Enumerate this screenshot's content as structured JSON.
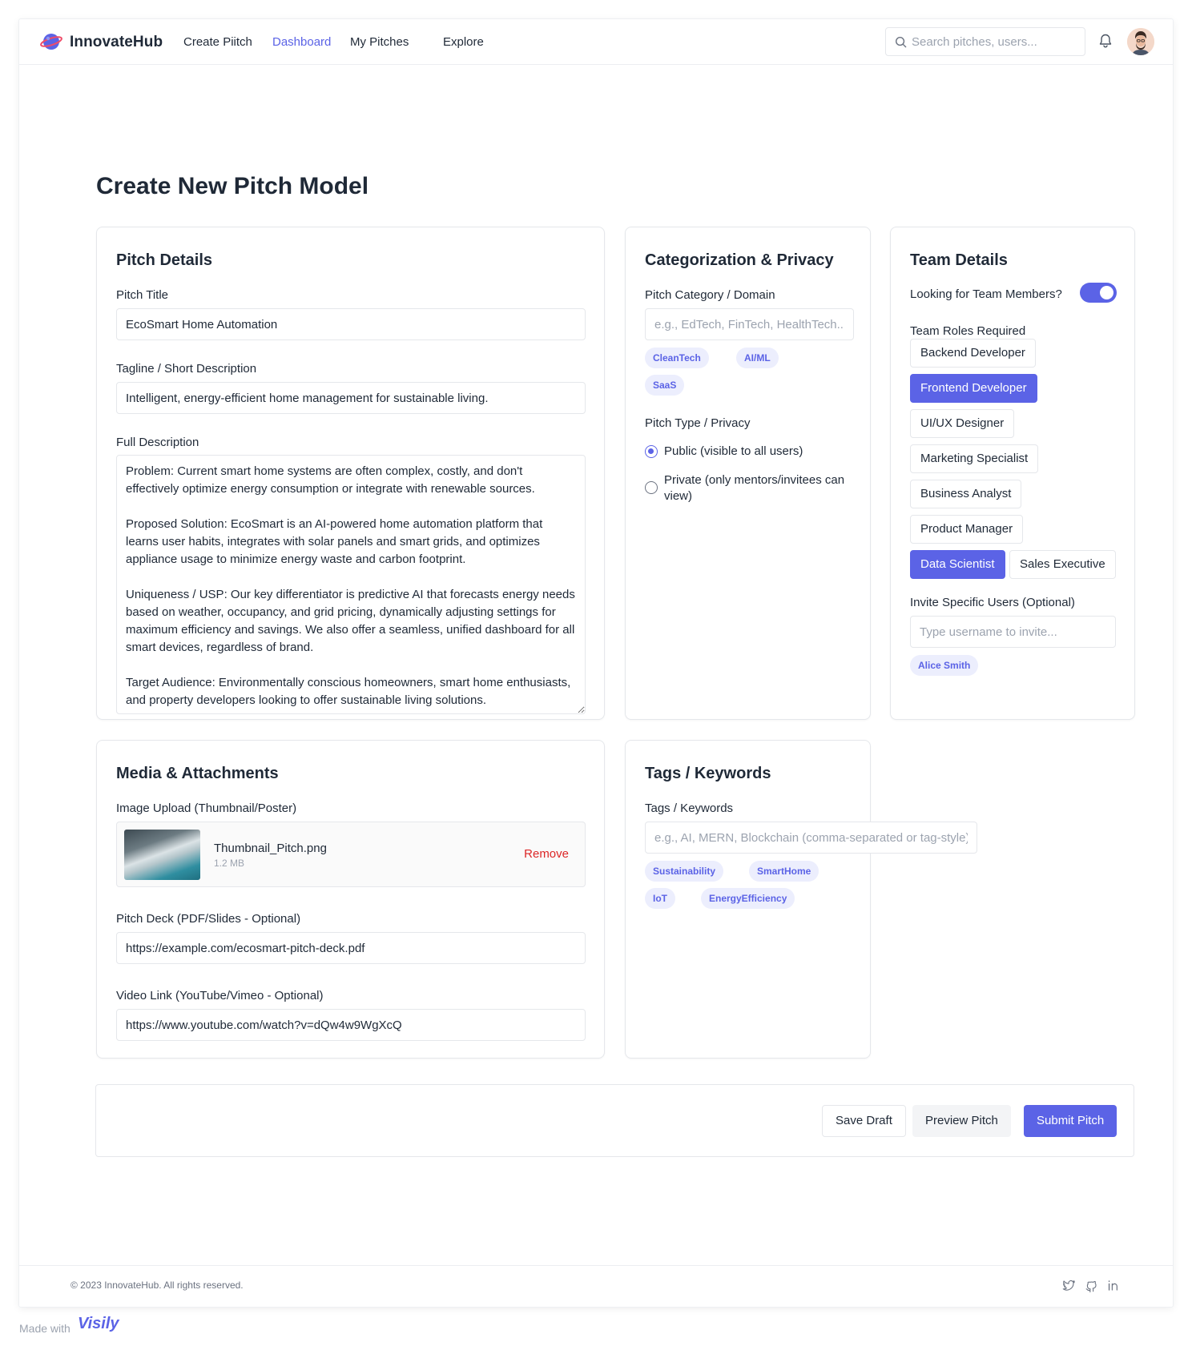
{
  "header": {
    "brand": "InnovateHub",
    "nav": [
      {
        "label": "Create Piitch",
        "active": false
      },
      {
        "label": "Dashboard",
        "active": true
      },
      {
        "label": "My Pitches",
        "active": false
      },
      {
        "label": "Explore",
        "active": false
      }
    ],
    "search_placeholder": "Search pitches, users...",
    "icons": {
      "logo": "planet-logo-icon",
      "search": "search-icon",
      "notifications": "bell-icon",
      "avatar": "user-avatar"
    }
  },
  "page_title": "Create New Pitch Model",
  "pitch_details": {
    "title": "Pitch Details",
    "pitch_title_label": "Pitch Title",
    "pitch_title_value": "EcoSmart Home Automation",
    "tagline_label": "Tagline / Short Description",
    "tagline_value": "Intelligent, energy-efficient home management for sustainable living.",
    "description_label": "Full Description",
    "description_value": "Problem: Current smart home systems are often complex, costly, and don't effectively optimize energy consumption or integrate with renewable sources.\n\nProposed Solution: EcoSmart is an AI-powered home automation platform that learns user habits, integrates with solar panels and smart grids, and optimizes appliance usage to minimize energy waste and carbon footprint.\n\nUniqueness / USP: Our key differentiator is predictive AI that forecasts energy needs based on weather, occupancy, and grid pricing, dynamically adjusting settings for maximum efficiency and savings. We also offer a seamless, unified dashboard for all smart devices, regardless of brand.\n\nTarget Audience: Environmentally conscious homeowners, smart home enthusiasts, and property developers looking to offer sustainable living solutions."
  },
  "categorization": {
    "title": "Categorization & Privacy",
    "category_label": "Pitch Category / Domain",
    "category_placeholder": "e.g., EdTech, FinTech, HealthTech...",
    "category_chips": [
      "CleanTech",
      "AI/ML",
      "SaaS"
    ],
    "privacy_label": "Pitch Type / Privacy",
    "privacy_options": [
      {
        "label": "Public (visible to all users)",
        "checked": true
      },
      {
        "label": "Private (only mentors/invitees can view)",
        "checked": false
      }
    ]
  },
  "team": {
    "title": "Team Details",
    "looking_label": "Looking for Team Members?",
    "looking_enabled": true,
    "roles_label": "Team Roles Required",
    "roles": [
      {
        "label": "Backend Developer",
        "selected": false
      },
      {
        "label": "Frontend Developer",
        "selected": true
      },
      {
        "label": "UI/UX Designer",
        "selected": false
      },
      {
        "label": "Marketing Specialist",
        "selected": false
      },
      {
        "label": "Business Analyst",
        "selected": false
      },
      {
        "label": "Product Manager",
        "selected": false
      },
      {
        "label": "Data Scientist",
        "selected": true
      },
      {
        "label": "Sales Executive",
        "selected": false
      }
    ],
    "invite_label": "Invite Specific Users (Optional)",
    "invite_placeholder": "Type username to invite...",
    "invited": [
      "Alice Smith"
    ]
  },
  "media": {
    "title": "Media & Attachments",
    "image_label": "Image Upload (Thumbnail/Poster)",
    "file_name": "Thumbnail_Pitch.png",
    "file_size": "1.2 MB",
    "remove_label": "Remove",
    "deck_label": "Pitch Deck (PDF/Slides - Optional)",
    "deck_value": "https://example.com/ecosmart-pitch-deck.pdf",
    "video_label": "Video Link (YouTube/Vimeo - Optional)",
    "video_value": "https://www.youtube.com/watch?v=dQw4w9WgXcQ"
  },
  "tags": {
    "title": "Tags / Keywords",
    "label": "Tags / Keywords",
    "placeholder": "e.g., AI, MERN, Blockchain (comma-separated or tag-style)",
    "chips": [
      "Sustainability",
      "SmartHome",
      "IoT",
      "EnergyEfficiency"
    ]
  },
  "actions": {
    "save_draft": "Save Draft",
    "preview": "Preview Pitch",
    "submit": "Submit Pitch"
  },
  "footer": {
    "copyright": "© 2023 InnovateHub. All rights reserved.",
    "social_icons": [
      "twitter-icon",
      "github-icon",
      "linkedin-icon"
    ]
  },
  "watermark": {
    "made_with": "Made with",
    "brand": "Visily"
  },
  "colors": {
    "accent": "#5b63e6",
    "danger": "#dc2626",
    "chip_bg": "#eceefd"
  }
}
